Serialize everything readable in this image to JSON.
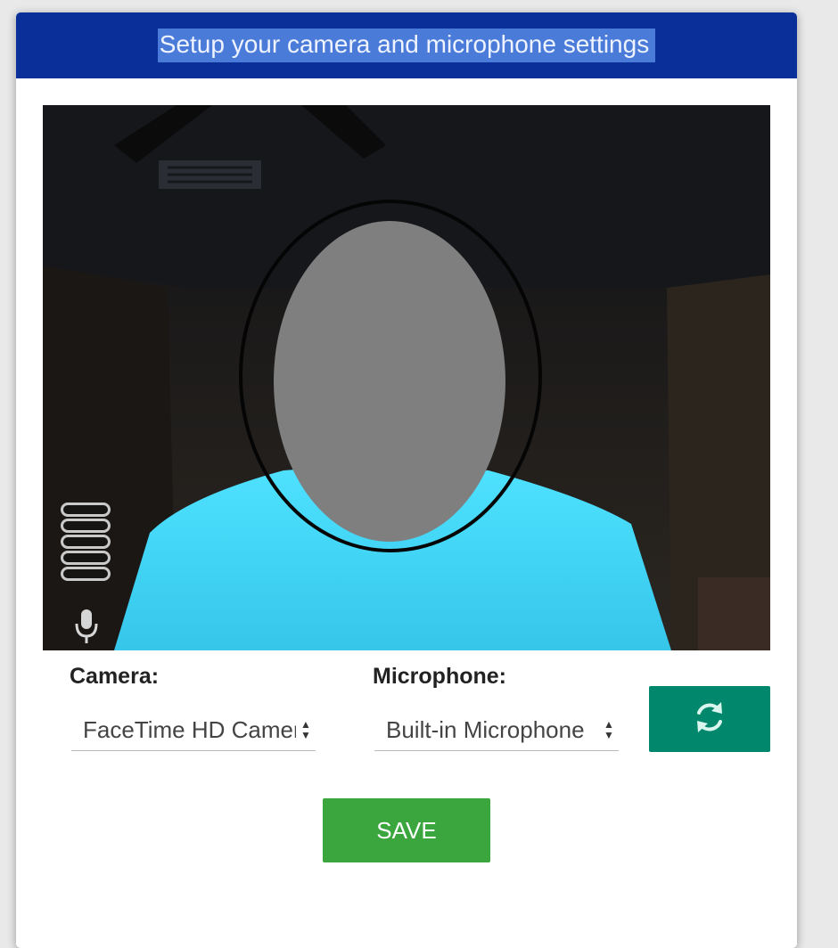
{
  "dialog": {
    "title": "Setup your camera and microphone settings"
  },
  "camera": {
    "label": "Camera:",
    "selected": "FaceTime HD Camera"
  },
  "microphone": {
    "label": "Microphone:",
    "selected": "Built-in Microphone",
    "level_bars_total": 5
  },
  "actions": {
    "save_label": "SAVE"
  },
  "icons": {
    "refresh": "refresh-icon",
    "microphone": "microphone-icon",
    "select_arrows": "select-arrows-icon"
  },
  "colors": {
    "header_bg": "#0a2f99",
    "title_highlight": "#4b7bd8",
    "refresh_button": "#01876b",
    "save_button": "#3aa63d"
  }
}
